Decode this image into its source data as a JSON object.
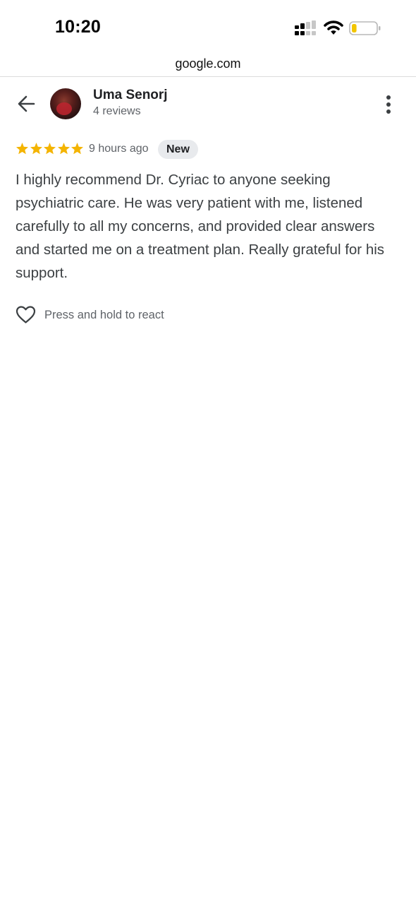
{
  "status_bar": {
    "time": "10:20",
    "icons": [
      "cellular-signal-icon",
      "wifi-icon",
      "battery-icon"
    ],
    "battery_level": 0.2
  },
  "browser": {
    "url": "google.com"
  },
  "header": {
    "back_icon": "arrow-left-icon",
    "reviewer_name": "Uma Senorj",
    "reviewer_reviews": "4 reviews",
    "more_icon": "more-vertical-icon"
  },
  "review": {
    "rating": 5,
    "rating_max": 5,
    "time_ago": "9 hours ago",
    "badge": "New",
    "text": "I highly recommend Dr. Cyriac to anyone seeking psychiatric care. He was very patient with me, listened carefully to all my concerns, and provided clear answers and started me on a treatment plan. Really grateful for his support."
  },
  "reaction": {
    "icon": "heart-outline-icon",
    "hint": "Press and hold to react"
  },
  "colors": {
    "star": "#f4b400",
    "badge_bg": "#e8eaed",
    "secondary_text": "#5f6368",
    "battery_fill": "#f2c500"
  }
}
